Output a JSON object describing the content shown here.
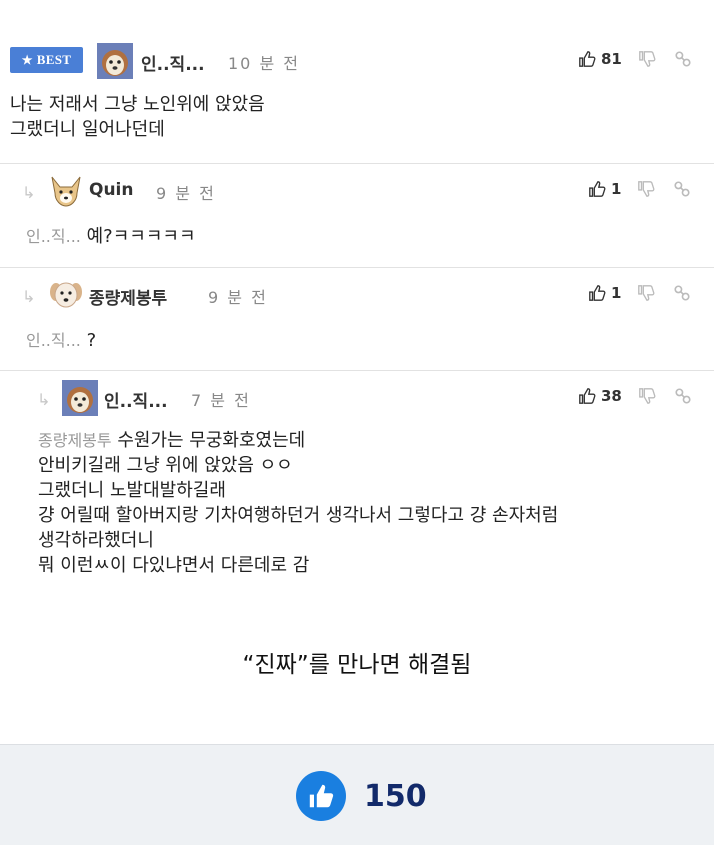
{
  "comments": [
    {
      "badge": "BEST",
      "nickname": "인..직...",
      "time": "10 분 전",
      "likes": "81",
      "lines": [
        "나는 저래서 그냥 노인위에 앉았음",
        "그랬더니 일어나던데"
      ]
    },
    {
      "nickname": "Quin",
      "time": "9 분 전",
      "likes": "1",
      "mention": "인..직...",
      "text": "예?ㅋㅋㅋㅋㅋ"
    },
    {
      "nickname": "종량제봉투",
      "time": "9 분 전",
      "likes": "1",
      "mention": "인..직...",
      "text": "?"
    },
    {
      "nickname": "인..직...",
      "time": "7 분 전",
      "likes": "38",
      "mention": "종량제봉투",
      "first_line": "수원가는 무궁화호였는데",
      "lines": [
        "안비키길래 그냥 위에 앉았음 ㅇㅇ",
        "그랬더니 노발대발하길래",
        "걍 어릴때 할아버지랑 기차여행하던거 생각나서 그렇다고 걍 손자처럼",
        "생각하라했더니",
        "뭐 이런ㅆ이 다있냐면서 다른데로 감"
      ]
    }
  ],
  "caption": "“진짜”를 만나면 해결됨",
  "footer": {
    "like_count": "150"
  },
  "colors": {
    "accent": "#4a7fd6",
    "footer_like": "#1a7fe0",
    "footer_count": "#122a6a"
  }
}
